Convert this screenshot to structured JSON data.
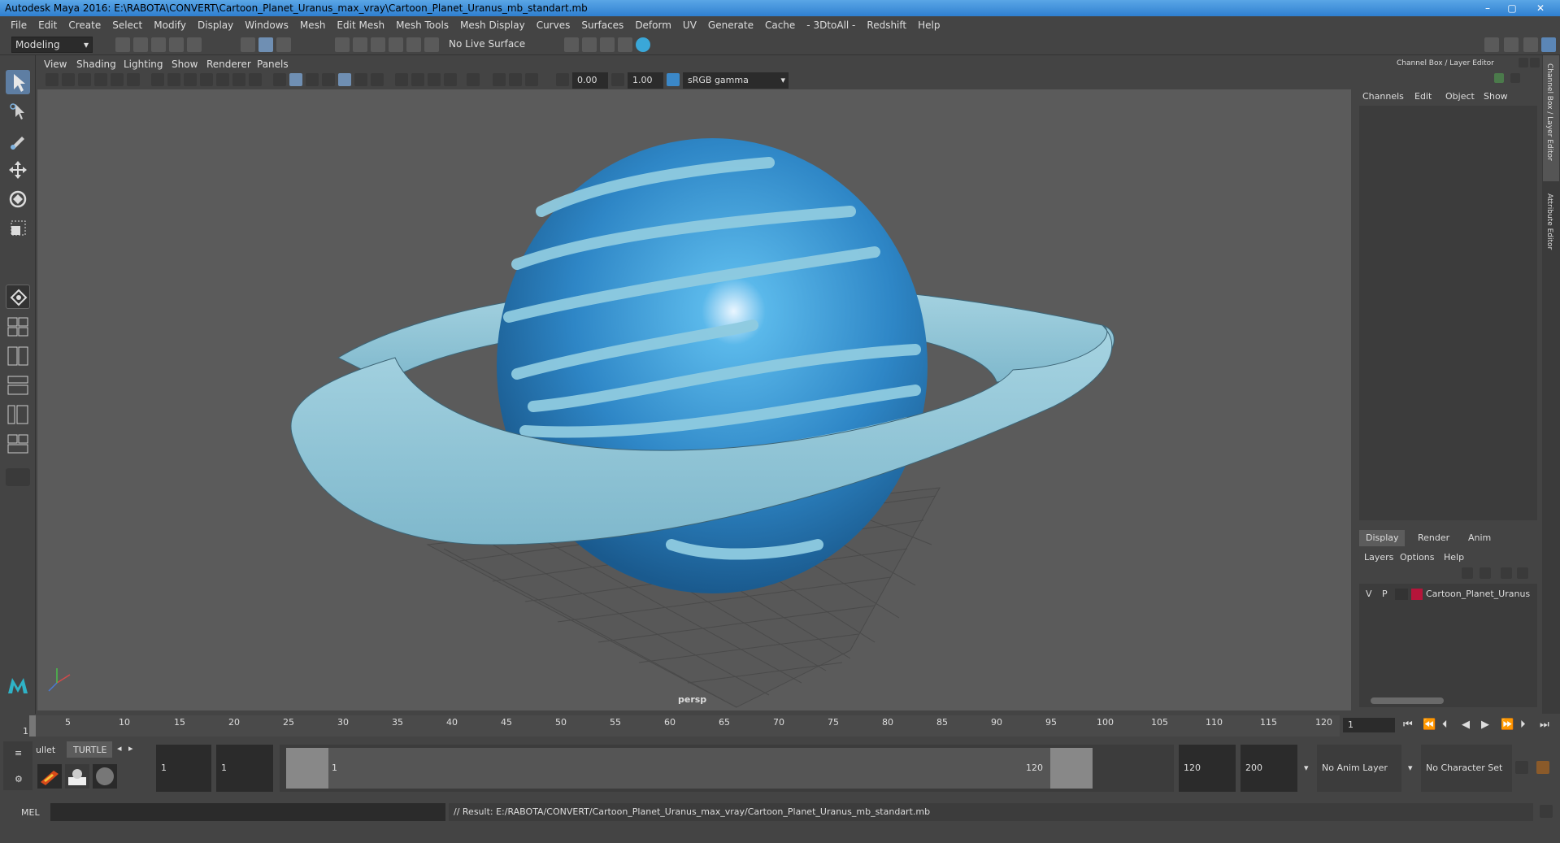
{
  "window": {
    "title": "Autodesk Maya 2016: E:\\RABOTA\\CONVERT\\Cartoon_Planet_Uranus_max_vray\\Cartoon_Planet_Uranus_mb_standart.mb",
    "minimize": "–",
    "maximize": "▢",
    "close": "✕"
  },
  "menubar": [
    "File",
    "Edit",
    "Create",
    "Select",
    "Modify",
    "Display",
    "Windows",
    "Mesh",
    "Edit Mesh",
    "Mesh Tools",
    "Mesh Display",
    "Curves",
    "Surfaces",
    "Deform",
    "UV",
    "Generate",
    "Cache",
    "- 3DtoAll -",
    "Redshift",
    "Help"
  ],
  "statusline": {
    "mode": "Modeling",
    "live_surface": "No Live Surface"
  },
  "viewport": {
    "menu": [
      "View",
      "Shading",
      "Lighting",
      "Show",
      "Renderer",
      "Panels"
    ],
    "exposure": "0.00",
    "gamma": "1.00",
    "color_space": "sRGB gamma",
    "camera_label": "persp"
  },
  "channel_box": {
    "header": "Channel Box / Layer Editor",
    "menu": [
      "Channels",
      "Edit",
      "Object",
      "Show"
    ],
    "side_tab_1": "Channel Box / Layer Editor",
    "side_tab_2": "Attribute Editor"
  },
  "layer_editor": {
    "tabs": [
      "Display",
      "Render",
      "Anim"
    ],
    "menu": [
      "Layers",
      "Options",
      "Help"
    ],
    "layers": [
      {
        "v": "V",
        "p": "P",
        "color": "#b5153a",
        "name": "Cartoon_Planet_Uranus"
      }
    ]
  },
  "timeline": {
    "ticks": [
      "1",
      "5",
      "10",
      "15",
      "20",
      "25",
      "30",
      "35",
      "40",
      "45",
      "50",
      "55",
      "60",
      "65",
      "70",
      "75",
      "80",
      "85",
      "90",
      "95",
      "100",
      "105",
      "110",
      "115",
      "120"
    ],
    "current_frame": "1"
  },
  "range": {
    "shelf_tabs": [
      "ullet",
      "TURTLE"
    ],
    "start": "1",
    "start_inner": "1",
    "slider_start": "1",
    "slider_end": "120",
    "end_inner": "120",
    "end": "200",
    "anim_layer": "No Anim Layer",
    "character_set": "No Character Set"
  },
  "command": {
    "lang": "MEL",
    "result": "// Result: E:/RABOTA/CONVERT/Cartoon_Planet_Uranus_max_vray/Cartoon_Planet_Uranus_mb_standart.mb"
  }
}
